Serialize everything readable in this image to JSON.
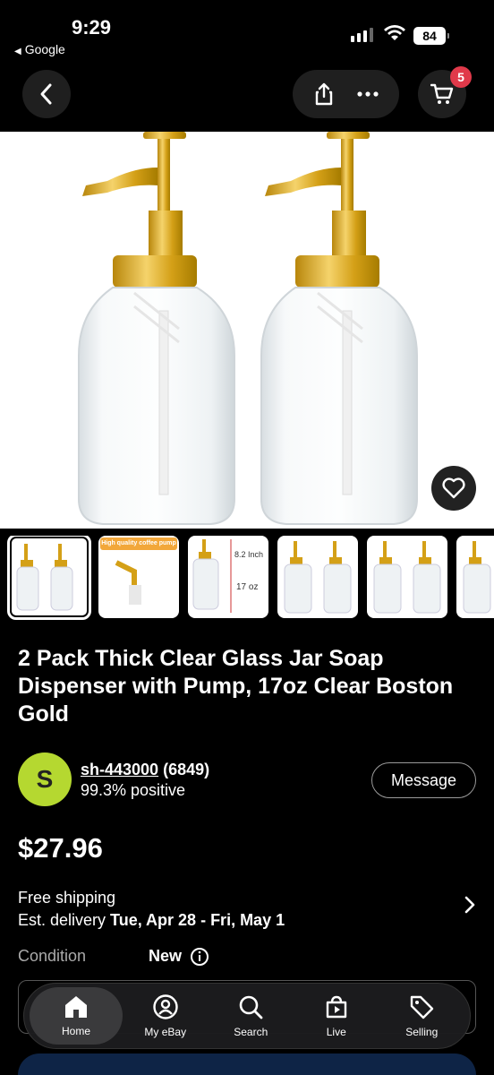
{
  "status": {
    "time": "9:29",
    "back_app": "Google",
    "battery": "84"
  },
  "nav": {
    "cart_count": "5"
  },
  "product": {
    "title": "2 Pack Thick Clear Glass Jar Soap Dispenser with Pump, 17oz Clear Boston Gold",
    "price": "$27.96",
    "thumb2_banner": "High quality coffee pump",
    "thumb3_height": "8.2 Inch",
    "thumb3_volume": "17 oz"
  },
  "seller": {
    "initial": "S",
    "name": "sh-443000",
    "feedback_count": "(6849)",
    "positive": "99.3% positive",
    "message_label": "Message"
  },
  "shipping": {
    "line1": "Free shipping",
    "delivery_prefix": "Est. delivery ",
    "delivery_dates": "Tue, Apr 28 - Fri, May 1"
  },
  "condition": {
    "label": "Condition",
    "value": "New"
  },
  "tabs": [
    {
      "label": "Home",
      "icon": "home-icon"
    },
    {
      "label": "My eBay",
      "icon": "profile-icon"
    },
    {
      "label": "Search",
      "icon": "search-icon"
    },
    {
      "label": "Live",
      "icon": "live-icon"
    },
    {
      "label": "Selling",
      "icon": "tag-icon"
    }
  ],
  "colors": {
    "accent_badge": "#e0394a",
    "avatar": "#b5d830",
    "gold": "#d4a017"
  }
}
